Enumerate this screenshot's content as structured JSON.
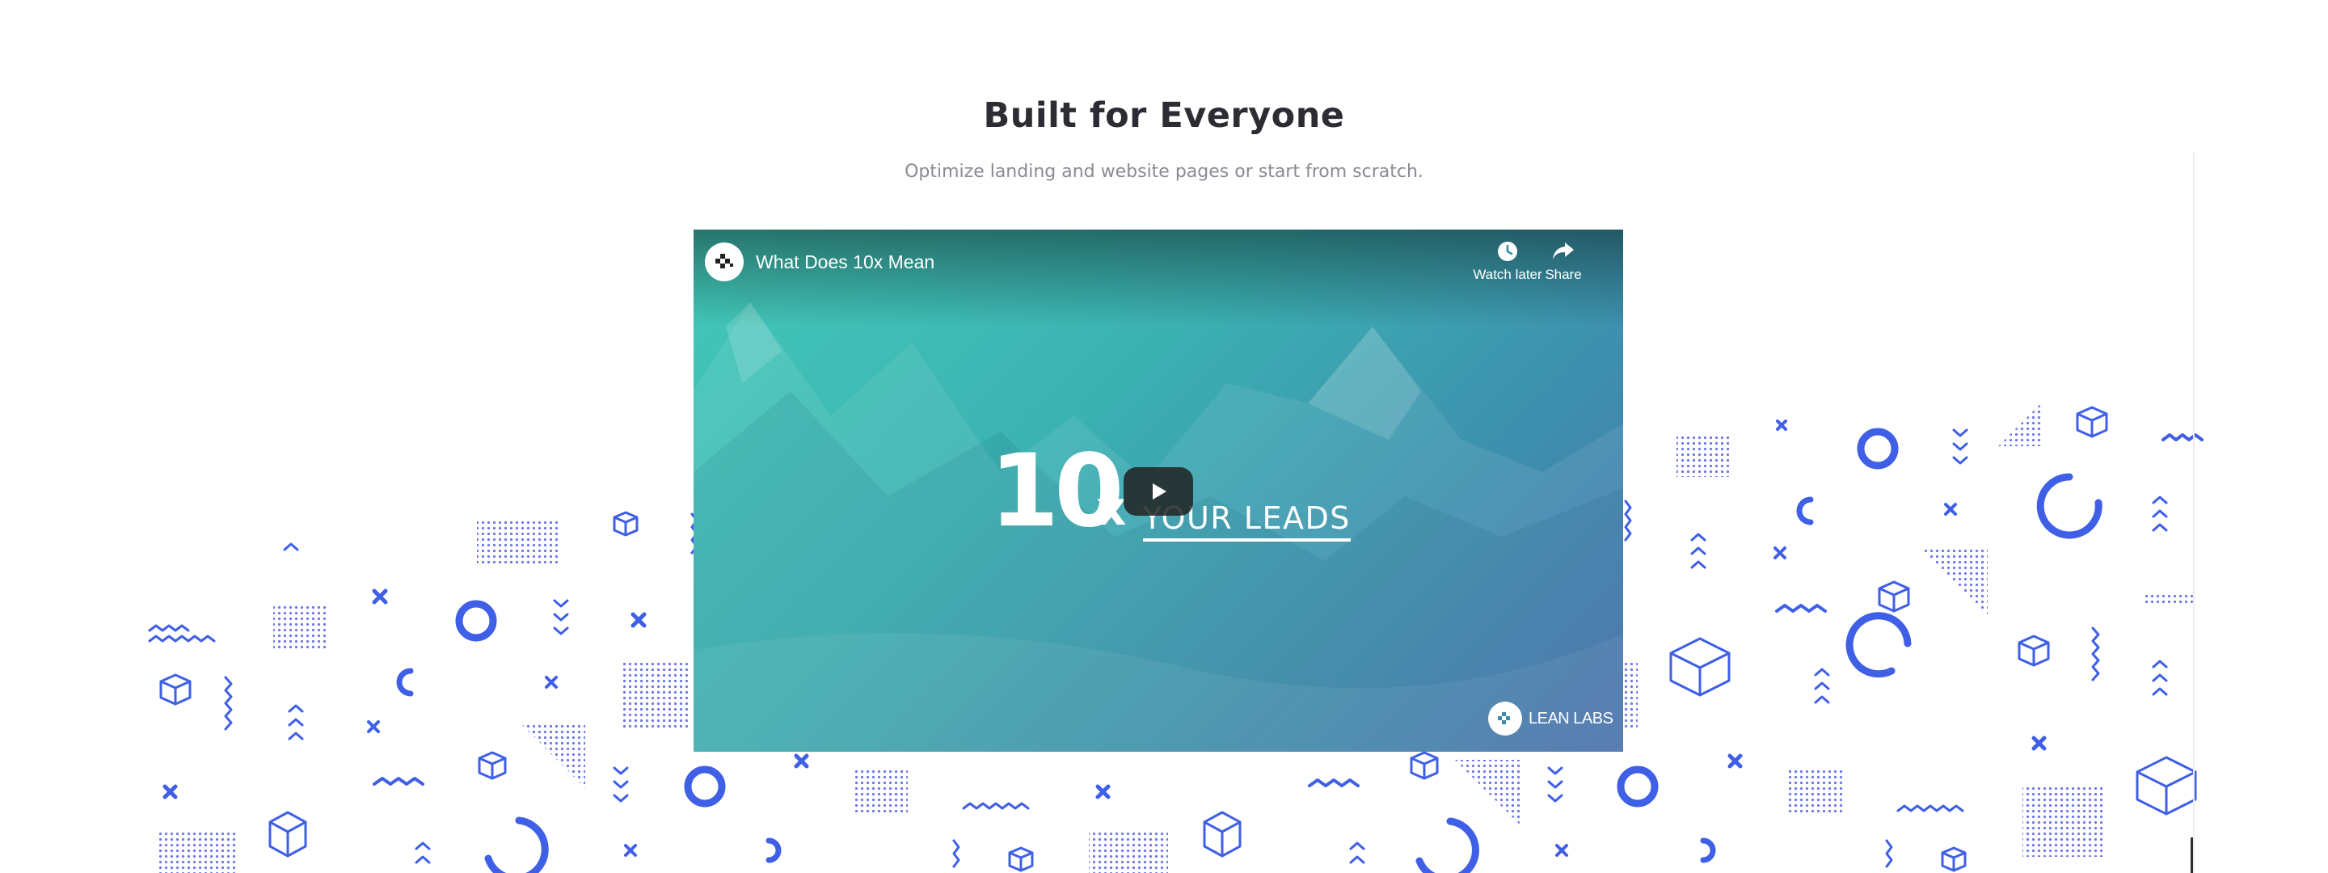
{
  "section": {
    "title": "Built for Everyone",
    "subtitle": "Optimize landing and website pages or start from scratch."
  },
  "video": {
    "title": "What Does 10x Mean",
    "channel_icon": "lean-labs-logo-icon",
    "watch_later_label": "Watch later",
    "watch_later_icon": "clock-icon",
    "share_label": "Share",
    "share_icon": "share-arrow-icon",
    "play_icon": "play-icon",
    "thumbnail": {
      "big_number": "10",
      "multiplier": "x",
      "tagline": "YOUR LEADS"
    },
    "brand_label": "LEAN LABS"
  },
  "colors": {
    "pattern": "#3f5fe6",
    "heading": "#2c2c33",
    "subtitle": "#8a8a93",
    "video_gradient_start": "#43c9b9",
    "video_gradient_end": "#4a6fb0"
  }
}
